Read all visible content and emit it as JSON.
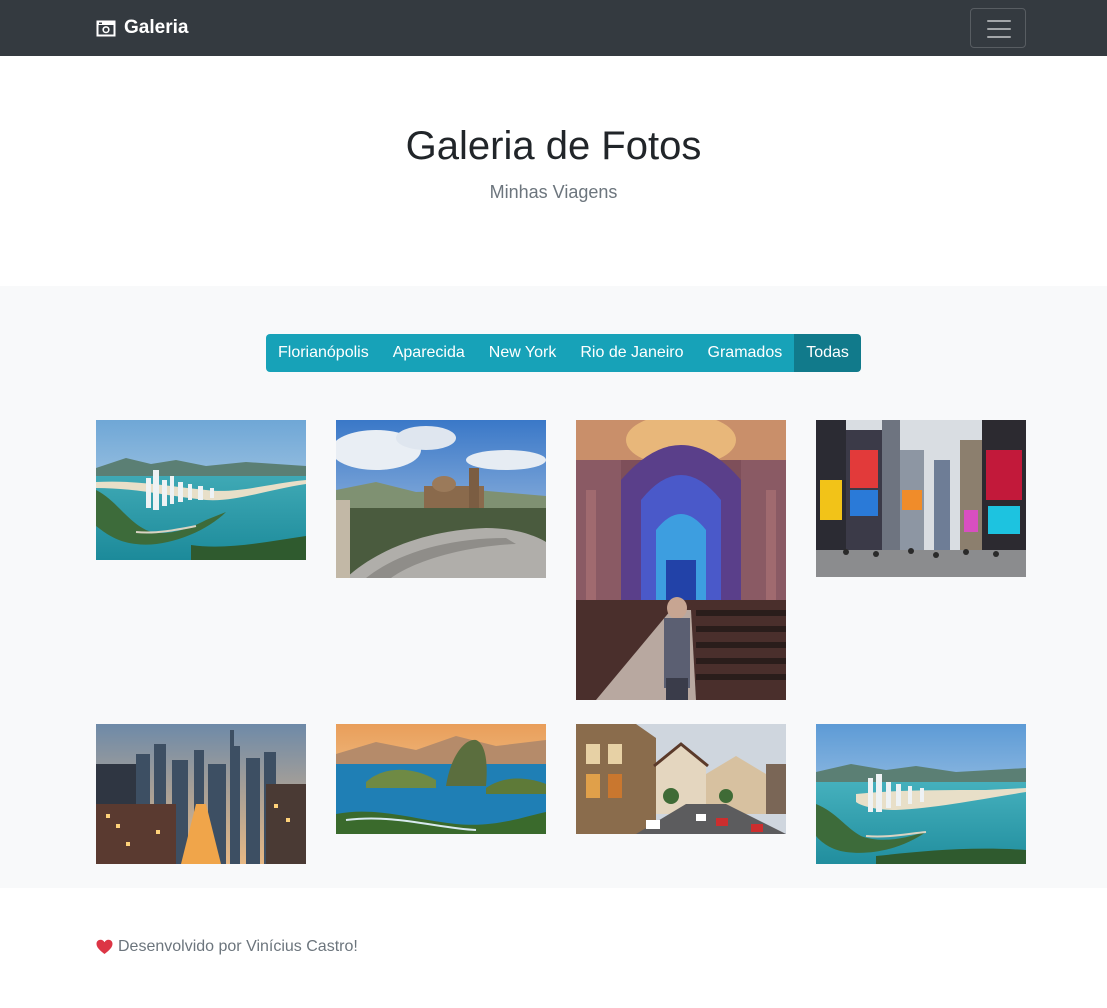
{
  "navbar": {
    "brand": "Galeria",
    "brand_icon": "camera-icon",
    "menu_icon": "hamburger-menu-icon"
  },
  "hero": {
    "title": "Galeria de Fotos",
    "subtitle": "Minhas Viagens"
  },
  "filters": [
    {
      "label": "Florianópolis",
      "active": false
    },
    {
      "label": "Aparecida",
      "active": false
    },
    {
      "label": "New York",
      "active": false
    },
    {
      "label": "Rio de Janeiro",
      "active": false
    },
    {
      "label": "Gramados",
      "active": false
    },
    {
      "label": "Todas",
      "active": true
    }
  ],
  "gallery": [
    {
      "subject": "florianopolis-aerial-photo"
    },
    {
      "subject": "aparecida-basilica-exterior-photo"
    },
    {
      "subject": "aparecida-basilica-interior-photo"
    },
    {
      "subject": "new-york-times-square-photo"
    },
    {
      "subject": "new-york-skyline-street-photo"
    },
    {
      "subject": "rio-de-janeiro-sugarloaf-photo"
    },
    {
      "subject": "gramado-street-photo"
    },
    {
      "subject": "florianopolis-coast-photo"
    }
  ],
  "footer": {
    "icon": "heart-icon",
    "text": "Desenvolvido por Vinícius Castro!"
  },
  "colors": {
    "navbar": "#343a40",
    "filter": "#17a2b8",
    "filter_active": "#117a8b",
    "album_bg": "#f8f9fa",
    "heart": "#dc3545"
  }
}
